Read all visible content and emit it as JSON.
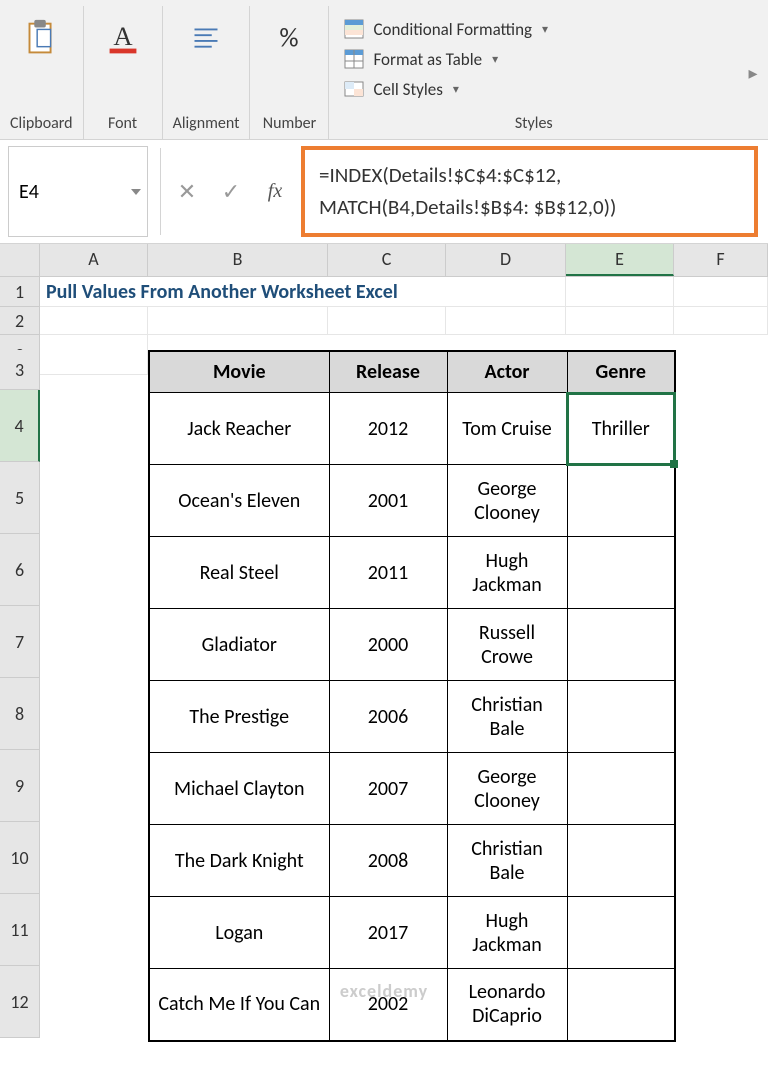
{
  "ribbon": {
    "clipboard": "Clipboard",
    "font": "Font",
    "alignment": "Alignment",
    "number": "Number",
    "percent": "%",
    "styles_label": "Styles",
    "cond_fmt": "Conditional Formatting",
    "fmt_table": "Format as Table",
    "cell_styles": "Cell Styles"
  },
  "namebox": "E4",
  "formula": "=INDEX(Details!$C$4:$C$12, MATCH(B4,Details!$B$4: $B$12,0))",
  "columns": [
    "A",
    "B",
    "C",
    "D",
    "E",
    "F"
  ],
  "title": "Pull Values From Another Worksheet Excel",
  "headers": {
    "movie": "Movie",
    "release": "Release",
    "actor": "Actor",
    "genre": "Genre"
  },
  "rows": [
    {
      "n": "4",
      "movie": "Jack Reacher",
      "release": "2012",
      "actor": "Tom Cruise",
      "genre": "Thriller"
    },
    {
      "n": "5",
      "movie": "Ocean's Eleven",
      "release": "2001",
      "actor": "George Clooney",
      "genre": ""
    },
    {
      "n": "6",
      "movie": "Real Steel",
      "release": "2011",
      "actor": "Hugh Jackman",
      "genre": ""
    },
    {
      "n": "7",
      "movie": "Gladiator",
      "release": "2000",
      "actor": "Russell Crowe",
      "genre": ""
    },
    {
      "n": "8",
      "movie": "The Prestige",
      "release": "2006",
      "actor": "Christian Bale",
      "genre": ""
    },
    {
      "n": "9",
      "movie": "Michael Clayton",
      "release": "2007",
      "actor": "George Clooney",
      "genre": ""
    },
    {
      "n": "10",
      "movie": "The Dark Knight",
      "release": "2008",
      "actor": "Christian Bale",
      "genre": ""
    },
    {
      "n": "11",
      "movie": "Logan",
      "release": "2017",
      "actor": "Hugh Jackman",
      "genre": ""
    },
    {
      "n": "12",
      "movie": "Catch Me If You Can",
      "release": "2002",
      "actor": "Leonardo DiCaprio",
      "genre": ""
    }
  ],
  "watermark": "exceldemy"
}
